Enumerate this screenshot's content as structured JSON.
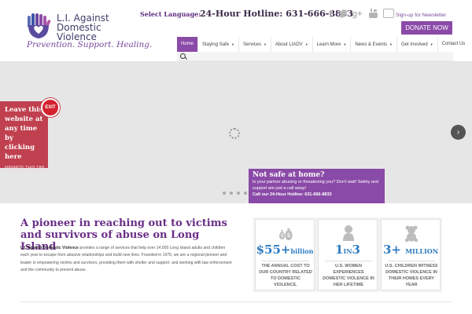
{
  "header": {
    "logo_line1": "L.I. Against",
    "logo_line2": "Domestic Violence",
    "tagline": "Prevention. Support. Healing.",
    "language_label": "Select Language:",
    "hotline": "24-Hour Hotline: 631-666-8833",
    "social_icons": [
      "facebook-icon",
      "twitter-icon",
      "google-plus-icon",
      "youtube-icon"
    ],
    "newsletter_label": "Sign-up for Newsletter",
    "donate_label": "DONATE NOW"
  },
  "nav": {
    "items": [
      {
        "label": "Home",
        "active": true,
        "caret": false
      },
      {
        "label": "Staying Safe",
        "active": false,
        "caret": true
      },
      {
        "label": "Services",
        "active": false,
        "caret": true
      },
      {
        "label": "About LIADV",
        "active": false,
        "caret": true
      },
      {
        "label": "Learn More",
        "active": false,
        "caret": true
      },
      {
        "label": "News & Events",
        "active": false,
        "caret": true
      },
      {
        "label": "Get Involved",
        "active": false,
        "caret": true
      },
      {
        "label": "Contact Us",
        "active": false,
        "caret": false
      }
    ]
  },
  "exit_widget": {
    "text": "Leave this website at any time by clicking here",
    "minimize_label": "MINIMIZE THIS TAB",
    "exit_label": "EXIT"
  },
  "safe_box": {
    "title": "Not safe at home?",
    "description": "Is your partner abusing or threatening you? Don't wait! Safety and support are just a call away!",
    "hotline": "Call our 24-Hour Hotline: 631-666-8833"
  },
  "intro": {
    "title": "A pioneer in reaching out to victims and survivors of abuse on Long Island",
    "org_name": "L.I. Against Domestic Violence",
    "body": "provides a range of services that help over 14,000 Long Island adults and children each year to escape from abusive relationships and build new lives. Founded in 1976, we are a regional pioneer and leader in empowering victims and survivors, providing them with shelter and support, and working with law enforcement and the community to prevent abuse."
  },
  "stats": [
    {
      "icon": "money-bags-icon",
      "value": "$55+",
      "unit": "billion",
      "caption": "The annual cost to our country related to domestic violence."
    },
    {
      "icon": "woman-icon",
      "value": "1",
      "mid": "IN",
      "value2": "3",
      "caption": "U.S. women experiences domestic violence in her lifetime"
    },
    {
      "icon": "teddy-bear-icon",
      "value": "3+",
      "unit": "MILLION",
      "caption": "U.S. children witness domestic violence in their homes every year"
    }
  ],
  "colors": {
    "brand_purple": "#8a4aa7",
    "exit_red": "#c0404f",
    "stat_blue": "#2e7cc0"
  }
}
